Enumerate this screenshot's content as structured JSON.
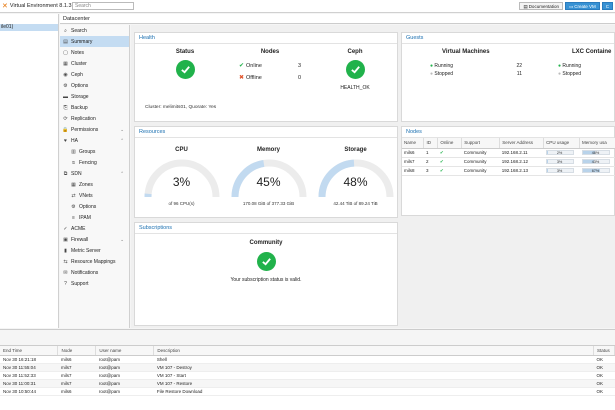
{
  "app": {
    "title": "Virtual Environment 8.1.3",
    "search_placeholder": "Search",
    "documentation": "Documentation",
    "create_vm": "Create VM",
    "create_ct": "C"
  },
  "tree": {
    "selected": "ile01)"
  },
  "breadcrumb": "Datacenter",
  "nav": [
    {
      "label": "Search",
      "icon": "⌕",
      "name": "search-icon"
    },
    {
      "label": "Summary",
      "icon": "▤",
      "name": "summary-icon",
      "selected": true
    },
    {
      "label": "Notes",
      "icon": "▢",
      "name": "notes-icon"
    },
    {
      "label": "Cluster",
      "icon": "▦",
      "name": "cluster-icon"
    },
    {
      "label": "Ceph",
      "icon": "◉",
      "name": "ceph-icon"
    },
    {
      "label": "Options",
      "icon": "⚙",
      "name": "gear-icon"
    },
    {
      "label": "Storage",
      "icon": "▬",
      "name": "storage-icon"
    },
    {
      "label": "Backup",
      "icon": "⎘",
      "name": "backup-icon"
    },
    {
      "label": "Replication",
      "icon": "⟳",
      "name": "replication-icon"
    },
    {
      "label": "Permissions",
      "icon": "🔒",
      "name": "lock-icon",
      "chevron": "⌄"
    },
    {
      "label": "HA",
      "icon": "♥",
      "name": "ha-icon",
      "chevron": "⌃"
    },
    {
      "label": "Groups",
      "icon": "▥",
      "name": "groups-icon",
      "sub": true
    },
    {
      "label": "Fencing",
      "icon": "⦸",
      "name": "fencing-icon",
      "sub": true
    },
    {
      "label": "SDN",
      "icon": "⧉",
      "name": "sdn-icon",
      "chevron": "⌃"
    },
    {
      "label": "Zones",
      "icon": "▦",
      "name": "zones-icon",
      "sub": true
    },
    {
      "label": "VNets",
      "icon": "⇄",
      "name": "vnets-icon",
      "sub": true
    },
    {
      "label": "Options",
      "icon": "⚙",
      "name": "sdn-options-icon",
      "sub": true
    },
    {
      "label": "IPAM",
      "icon": "≡",
      "name": "ipam-icon",
      "sub": true
    },
    {
      "label": "ACME",
      "icon": "✓",
      "name": "acme-icon"
    },
    {
      "label": "Firewall",
      "icon": "▣",
      "name": "firewall-icon",
      "chevron": "⌄"
    },
    {
      "label": "Metric Server",
      "icon": "▮",
      "name": "metric-icon"
    },
    {
      "label": "Resource Mappings",
      "icon": "⇆",
      "name": "mapping-icon"
    },
    {
      "label": "Notifications",
      "icon": "✉",
      "name": "notifications-icon"
    },
    {
      "label": "Support",
      "icon": "?",
      "name": "support-icon"
    }
  ],
  "health": {
    "title": "Health",
    "status_label": "Status",
    "nodes_label": "Nodes",
    "online_label": "Online",
    "online_count": "3",
    "offline_label": "Offline",
    "offline_count": "0",
    "ceph_label": "Ceph",
    "ceph_status": "HEALTH_OK",
    "cluster_text": "Cluster: melimits01, Quorate: Yes"
  },
  "guests": {
    "title": "Guests",
    "vm_label": "Virtual Machines",
    "vm_running_label": "Running",
    "vm_running": "22",
    "vm_stopped_label": "Stopped",
    "vm_stopped": "11",
    "lxc_label": "LXC Containe",
    "lxc_running_label": "Running",
    "lxc_stopped_label": "Stopped"
  },
  "resources": {
    "title": "Resources",
    "gauges": [
      {
        "label": "CPU",
        "pct": "3%",
        "value": 0.03,
        "sub": "of 96 CPU(s)"
      },
      {
        "label": "Memory",
        "pct": "45%",
        "value": 0.45,
        "sub": "170.08 GiB of 377.33 GiB"
      },
      {
        "label": "Storage",
        "pct": "48%",
        "value": 0.48,
        "sub": "42.44 TiB of 89.24 TiB"
      }
    ]
  },
  "nodes": {
    "title": "Nodes",
    "columns": [
      "Name",
      "ID",
      "Online",
      "Support",
      "Server Address",
      "CPU usage",
      "Memory usa"
    ],
    "rows": [
      {
        "name": "mils6",
        "id": "1",
        "support": "Community",
        "address": "192.168.2.11",
        "cpu": "2%",
        "cpu_v": 0.02,
        "mem": "48%",
        "mem_v": 0.48
      },
      {
        "name": "mils7",
        "id": "2",
        "support": "Community",
        "address": "192.168.2.12",
        "cpu": "3%",
        "cpu_v": 0.03,
        "mem": "43%",
        "mem_v": 0.43
      },
      {
        "name": "mils8",
        "id": "3",
        "support": "Community",
        "address": "192.168.2.13",
        "cpu": "3%",
        "cpu_v": 0.03,
        "mem": "67%",
        "mem_v": 0.67
      }
    ]
  },
  "subscriptions": {
    "title": "Subscriptions",
    "type": "Community",
    "text": "Your subscription status is valid."
  },
  "tasks": {
    "columns": [
      "End Time",
      "Node",
      "User name",
      "Description",
      "Status"
    ],
    "rows": [
      {
        "time": "Nov 30 16:21:18",
        "node": "mils6",
        "user": "root@pam",
        "desc": "Shell",
        "status": "OK"
      },
      {
        "time": "Nov 30 11:55:04",
        "node": "mils7",
        "user": "root@pam",
        "desc": "VM 107 - Destroy",
        "status": "OK"
      },
      {
        "time": "Nov 30 11:52:33",
        "node": "mils7",
        "user": "root@pam",
        "desc": "VM 107 - Start",
        "status": "OK"
      },
      {
        "time": "Nov 30 11:00:31",
        "node": "mils7",
        "user": "root@pam",
        "desc": "VM 107 - Restore",
        "status": "OK"
      },
      {
        "time": "Nov 30 10:50:44",
        "node": "mils6",
        "user": "root@pam",
        "desc": "File Restore Download",
        "status": "OK"
      }
    ]
  },
  "colors": {
    "accent": "#3892d4",
    "ok": "#21b24b",
    "error": "#e0542c",
    "title": "#1a6fb0"
  }
}
